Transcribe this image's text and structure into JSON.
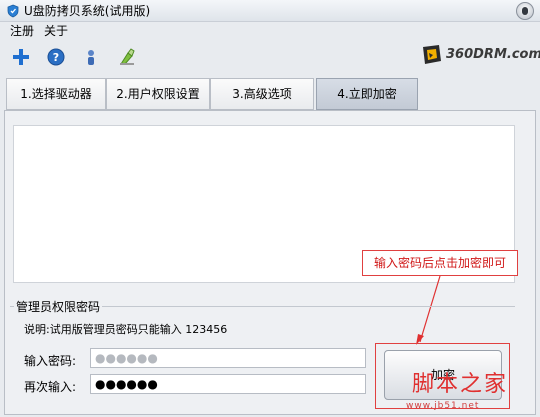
{
  "window": {
    "title": "U盘防拷贝系统(试用版)"
  },
  "menu": {
    "items": [
      "注册",
      "关于"
    ]
  },
  "toolbar": {
    "icons": [
      "plus-icon",
      "help-icon",
      "user-icon",
      "clean-icon"
    ]
  },
  "brand": {
    "logo_text": "360DRM.com"
  },
  "tabs": [
    {
      "label": "1.选择驱动器"
    },
    {
      "label": "2.用户权限设置"
    },
    {
      "label": "3.高级选项"
    },
    {
      "label": "4.立即加密"
    }
  ],
  "active_tab": 3,
  "annotation": {
    "text": "输入密码后点击加密即可"
  },
  "admin_password": {
    "group_title": "管理员权限密码",
    "note": "说明:试用版管理员密码只能输入 123456",
    "password_label": "输入密码:",
    "password_value": "●●●●●●",
    "confirm_label": "再次输入:",
    "confirm_value": "●●●●●●",
    "encrypt_label": "加密"
  },
  "watermark": {
    "text": "脚本之家",
    "url": "www.jb51.net"
  },
  "colors": {
    "annotation_red": "#d01818",
    "active_tab": "#c3cad5"
  }
}
